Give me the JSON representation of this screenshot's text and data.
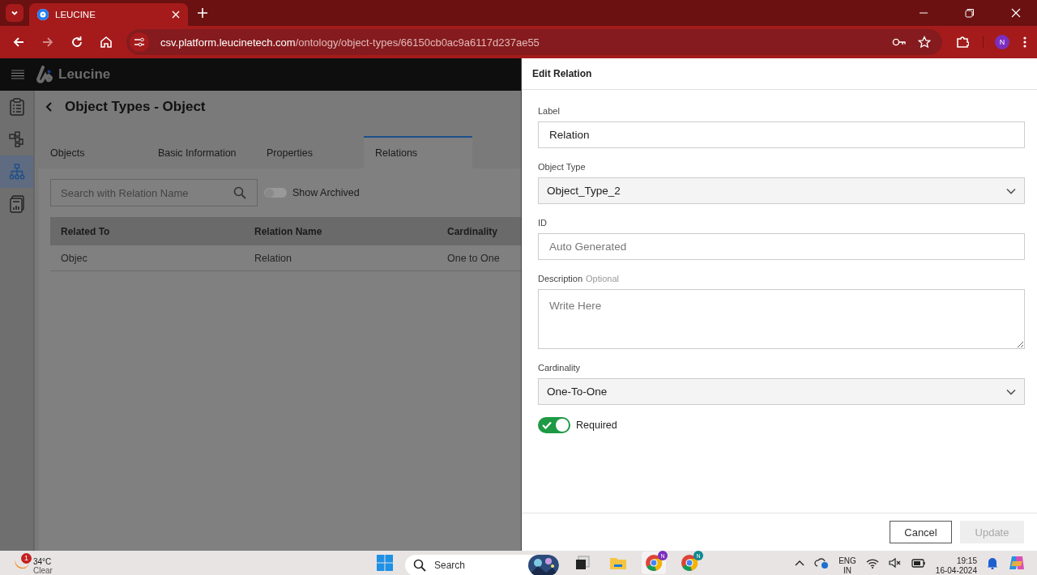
{
  "browser": {
    "tabs": [
      {
        "title": "LEUCINE",
        "selected": true
      }
    ],
    "url": {
      "host": "csv.platform.leucinetech.com",
      "path": "/ontology/object-types/66150cb0ac9a6117d237ae55"
    },
    "profile": "N"
  },
  "app": {
    "brand": "Leucine",
    "nav": [
      {
        "kind": "checklist",
        "selected": false
      },
      {
        "kind": "flow",
        "selected": false
      },
      {
        "kind": "hierarchy",
        "selected": true
      },
      {
        "kind": "report",
        "selected": false
      }
    ],
    "title": "Object Types - Object",
    "tabs": [
      {
        "label": "Objects",
        "selected": false
      },
      {
        "label": "Basic Information",
        "selected": false
      },
      {
        "label": "Properties",
        "selected": false
      },
      {
        "label": "Relations",
        "selected": true
      }
    ],
    "search": {
      "placeholder": "Search with Relation Name"
    },
    "show_archived": {
      "label": "Show Archived",
      "on": false
    },
    "table": {
      "columns": [
        "Related To",
        "Relation Name",
        "Cardinality"
      ],
      "rows": [
        [
          "Objec",
          "Relation",
          "One to One"
        ]
      ]
    }
  },
  "drawer": {
    "title": "Edit Relation",
    "fields": [
      {
        "kind": "text",
        "label": "Label",
        "value": "Relation"
      },
      {
        "kind": "select",
        "label": "Object Type",
        "value": "Object_Type_2"
      },
      {
        "kind": "text",
        "label": "ID",
        "placeholder": "Auto Generated"
      },
      {
        "kind": "textarea",
        "label": "Description",
        "optional": "Optional",
        "placeholder": "Write Here"
      },
      {
        "kind": "select",
        "label": "Cardinality",
        "value": "One-To-One"
      }
    ],
    "toggle": {
      "label": "Required",
      "on": true
    },
    "buttons": [
      {
        "label": "Cancel",
        "disabled": false
      },
      {
        "label": "Update",
        "disabled": true
      }
    ]
  },
  "taskbar": {
    "weather": {
      "badge": "1",
      "temp": "34°C",
      "condition": "Clear"
    },
    "search": "Search",
    "apps": [
      {
        "kind": "terminal"
      },
      {
        "kind": "folder"
      },
      {
        "kind": "chrome",
        "badge": "N",
        "color": "#7b2fbe",
        "selected": true
      },
      {
        "kind": "chrome",
        "badge": "N",
        "color": "#10898f",
        "selected": false
      }
    ],
    "lang": [
      "ENG",
      "IN"
    ],
    "time": "19:15",
    "date": "16-04-2024"
  }
}
